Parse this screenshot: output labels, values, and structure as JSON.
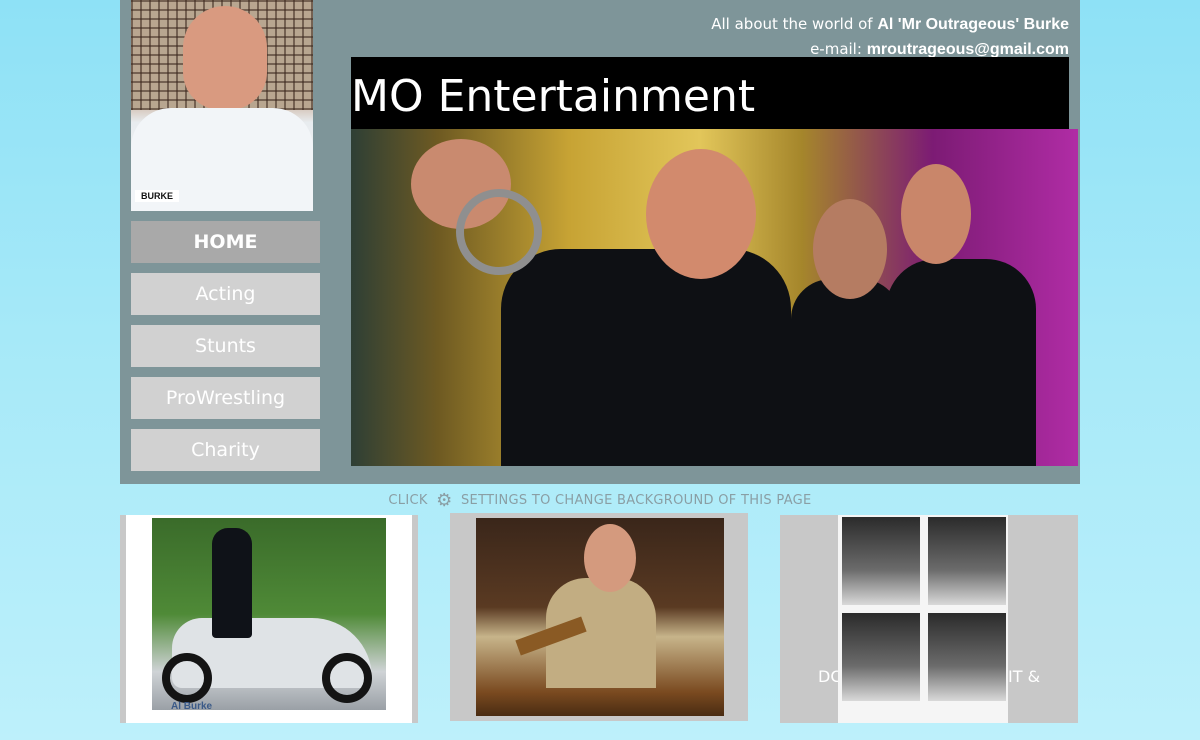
{
  "header": {
    "tagline_prefix": "All about the world of",
    "tagline_name": "Al 'Mr Outrageous' Burke",
    "email_label": "e-mail:",
    "email": "mroutrageous@gmail.com",
    "brand_title": "MO Entertainment",
    "portrait_nametag": "BURKE"
  },
  "nav": {
    "items": [
      {
        "label": "HOME",
        "active": true
      },
      {
        "label": "Acting"
      },
      {
        "label": "Stunts"
      },
      {
        "label": "ProWrestling"
      },
      {
        "label": "Charity"
      }
    ]
  },
  "settings_hint": {
    "before": "CLICK",
    "icon": "gear-icon",
    "after": "SETTINGS TO CHANGE BACKGROUND OF THIS PAGE"
  },
  "cards": {
    "card1_caption": "Al Burke",
    "card3_overlay_left": "DC",
    "card3_overlay_right": "IT &"
  },
  "colors": {
    "header_bg": "#7e9599",
    "nav_bg": "#d1d1d1",
    "nav_active_bg": "#a9a9a9",
    "brand_bg": "#000000"
  }
}
